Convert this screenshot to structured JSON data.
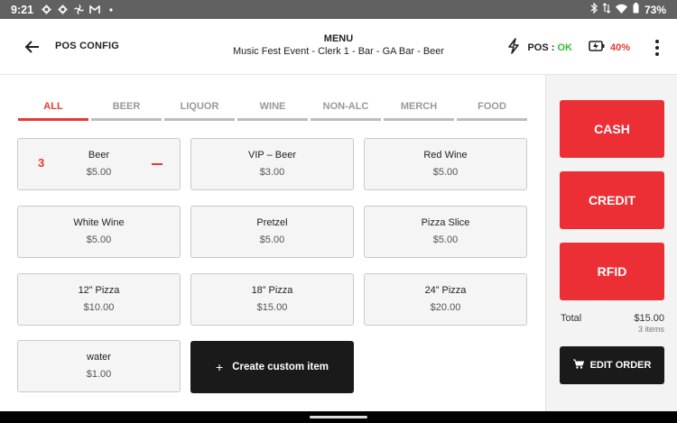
{
  "status_bar": {
    "time": "9:21",
    "left_icons": [
      "gear-icon",
      "gear-icon",
      "fan-icon",
      "gmail-icon",
      "dot-icon"
    ],
    "battery": "73%"
  },
  "header": {
    "back_icon": "arrow-left-icon",
    "pos_config": "POS CONFIG",
    "menu_title": "MENU",
    "menu_subtitle": "Music Fest Event - Clerk 1 - Bar - GA Bar - Beer",
    "pos_label": "POS :",
    "pos_status": "OK",
    "battery_level": "40%",
    "colors": {
      "ok": "#2fbf2f",
      "battery": "#e53935"
    }
  },
  "tabs": [
    {
      "label": "ALL",
      "active": true
    },
    {
      "label": "BEER"
    },
    {
      "label": "LIQUOR"
    },
    {
      "label": "WINE"
    },
    {
      "label": "NON-ALC"
    },
    {
      "label": "MERCH"
    },
    {
      "label": "FOOD"
    }
  ],
  "items": [
    {
      "name": "Beer",
      "price": "$5.00",
      "qty": "3"
    },
    {
      "name": "VIP – Beer",
      "price": "$3.00"
    },
    {
      "name": "Red Wine",
      "price": "$5.00"
    },
    {
      "name": "White Wine",
      "price": "$5.00"
    },
    {
      "name": "Pretzel",
      "price": "$5.00"
    },
    {
      "name": "Pizza Slice",
      "price": "$5.00"
    },
    {
      "name": "12” Pizza",
      "price": "$10.00"
    },
    {
      "name": "18” Pizza",
      "price": "$15.00"
    },
    {
      "name": "24” Pizza",
      "price": "$20.00"
    },
    {
      "name": "water",
      "price": "$1.00"
    }
  ],
  "custom_item": {
    "plus": "+",
    "label": "Create custom item"
  },
  "side": {
    "cash": "CASH",
    "credit": "CREDIT",
    "rfid": "RFID",
    "total_label": "Total",
    "total_value": "$15.00",
    "total_items": "3 items",
    "edit_order": "EDIT ORDER",
    "accent": "#ec2f35"
  }
}
